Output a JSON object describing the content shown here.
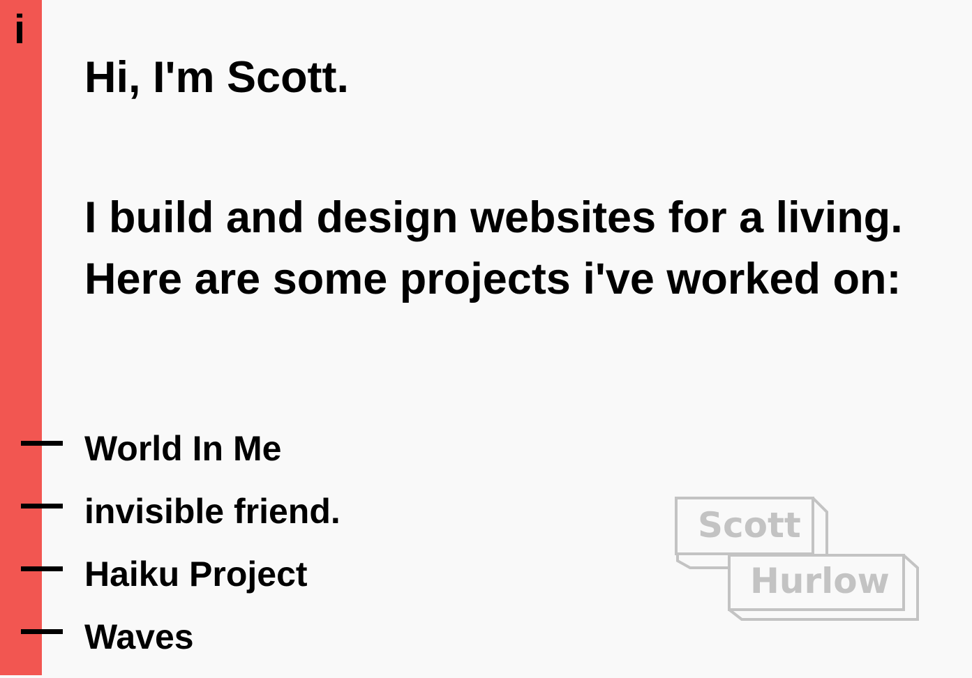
{
  "sidebar": {
    "icon": "i",
    "color": "#f25651"
  },
  "intro": {
    "greeting": "Hi, I'm Scott.",
    "description": "I build and design websites for a living. Here are some projects i've worked on:"
  },
  "projects": [
    {
      "label": "World In Me"
    },
    {
      "label": "invisible friend."
    },
    {
      "label": "Haiku Project"
    },
    {
      "label": "Waves"
    }
  ],
  "logo": {
    "line1": "Scott",
    "line2": "Hurlow",
    "color": "#c3c3c3"
  }
}
